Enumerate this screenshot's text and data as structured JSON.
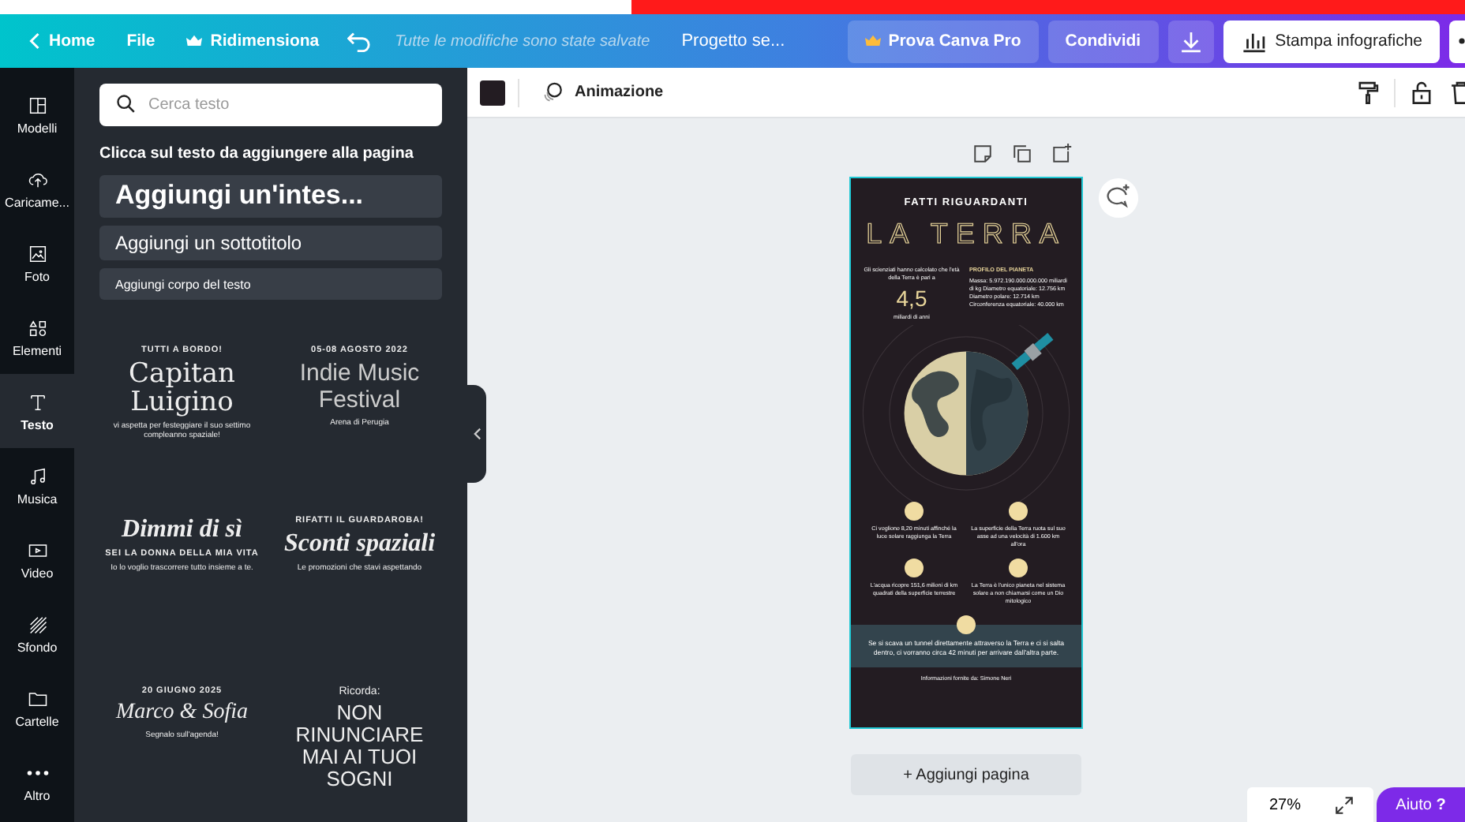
{
  "header": {
    "back": "Home",
    "menu": [
      {
        "label": "File",
        "kind": "plain"
      },
      {
        "label": "Ridimensiona",
        "kind": "crown"
      }
    ],
    "save_status": "Tutte le modifiche sono state salvate",
    "project_title": "Progetto se...",
    "buttons": [
      {
        "label": "Prova Canva Pro",
        "kind": "pro"
      },
      {
        "label": "Condividi",
        "kind": "share"
      },
      {
        "kind": "download"
      },
      {
        "label": "Stampa infografiche",
        "kind": "print"
      },
      {
        "kind": "more"
      }
    ]
  },
  "rail": [
    {
      "label": "Modelli",
      "kind": "templates",
      "selected": false
    },
    {
      "label": "Caricame...",
      "kind": "uploads",
      "selected": false
    },
    {
      "label": "Foto",
      "kind": "photos",
      "selected": false
    },
    {
      "label": "Elementi",
      "kind": "elements",
      "selected": false
    },
    {
      "label": "Testo",
      "kind": "text",
      "selected": true
    },
    {
      "label": "Musica",
      "kind": "music",
      "selected": false
    },
    {
      "label": "Video",
      "kind": "video",
      "selected": false
    },
    {
      "label": "Sfondo",
      "kind": "background",
      "selected": false
    },
    {
      "label": "Cartelle",
      "kind": "folders",
      "selected": false
    },
    {
      "label": "Altro",
      "kind": "more",
      "selected": false
    }
  ],
  "panel": {
    "search": {
      "placeholder": "Cerca testo"
    },
    "hint": "Clicca sul testo da aggiungere alla pagina",
    "presets": [
      {
        "label": "Aggiungi un'intes...",
        "kind": "heading"
      },
      {
        "label": "Aggiungi un sottotitolo",
        "kind": "subheading"
      },
      {
        "label": "Aggiungi corpo del testo",
        "kind": "body"
      }
    ],
    "templates": [
      {
        "lines": [
          {
            "text": "TUTTI A BORDO!",
            "kind": "kicker"
          },
          {
            "text": "Capitan Luigino",
            "kind": "serif"
          },
          {
            "text": "vi aspetta per festeggiare il suo settimo compleanno spaziale!",
            "kind": "caption"
          }
        ]
      },
      {
        "lines": [
          {
            "text": "05-08 AGOSTO 2022",
            "kind": "kicker"
          },
          {
            "text": "Indie Music Festival",
            "kind": "grunge"
          },
          {
            "text": "Arena di Perugia",
            "kind": "caption"
          }
        ]
      },
      {
        "lines": [
          {
            "text": "Dimmi di sì",
            "kind": "script"
          },
          {
            "text": "SEI LA DONNA DELLA MIA VITA",
            "kind": "kicker"
          },
          {
            "text": "Io lo voglio trascorrere tutto insieme a te.",
            "kind": "caption"
          }
        ]
      },
      {
        "lines": [
          {
            "text": "RIFATTI IL GUARDAROBA!",
            "kind": "kicker"
          },
          {
            "text": "Sconti spaziali",
            "kind": "script"
          },
          {
            "text": "Le promozioni che stavi aspettando",
            "kind": "caption"
          }
        ]
      },
      {
        "lines": [
          {
            "text": "20 GIUGNO 2025",
            "kind": "kicker"
          },
          {
            "text": "Marco & Sofia",
            "kind": "italic"
          },
          {
            "text": "Segnalo sull'agenda!",
            "kind": "caption"
          }
        ]
      },
      {
        "lines": [
          {
            "text": "Ricorda:",
            "kind": "lead"
          },
          {
            "text": "NON RINUNCIARE MAI AI TUOI SOGNI",
            "kind": "sans"
          }
        ]
      }
    ]
  },
  "toolbar": {
    "animation": "Animazione"
  },
  "infographic": {
    "kicker": "FATTI RIGUARDANTI",
    "title": "LA TERRA",
    "age_intro": "Gli scienziati hanno calcolato che l'età della Terra è pari a",
    "age_value": "4,5",
    "age_unit": "miliardi di anni",
    "profile_title": "PROFILO DEL PIANETA",
    "profile_text": "Massa: 5.972.190.000.000.000 miliardi di kg Diametro equatoriale: 12.756 km Diametro polare: 12.714 km Circonferenza equatoriale: 40.000 km",
    "facts": [
      "Ci vogliono 8,20 minuti affinché la luce solare raggiunga la Terra",
      "La superficie della Terra ruota sul suo asse ad una velocità di 1.600 km all'ora",
      "L'acqua ricopre 151,6 milioni di km quadrati della superficie terrestre",
      "La Terra è l'unico pianeta nel sistema solare a non chiamarsi come un Dio mitologico"
    ],
    "band_text": "Se si scava un tunnel direttamente attraverso la Terra e ci si salta dentro, ci vorranno circa 42 minuti per arrivare dall'altra parte.",
    "credit": "Informazioni fornite da: Simone Neri"
  },
  "add_page": "+ Aggiungi pagina",
  "footer": {
    "zoom": "27%",
    "help": "Aiuto",
    "help_icon": "?"
  }
}
